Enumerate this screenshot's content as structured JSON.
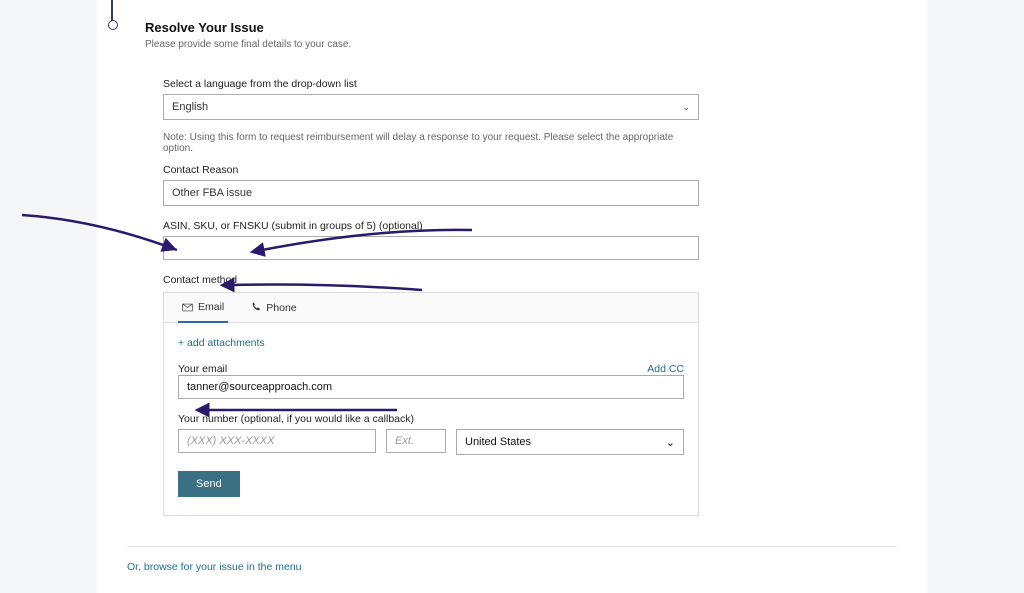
{
  "header": {
    "title": "Resolve Your Issue",
    "subtitle": "Please provide some final details to your case."
  },
  "language": {
    "label": "Select a language from the drop-down list",
    "selected": "English"
  },
  "note": "Note: Using this form to request reimbursement will delay a response to your request. Please select the appropriate option.",
  "reason": {
    "label": "Contact Reason",
    "value": "Other FBA issue"
  },
  "asin": {
    "label": "ASIN, SKU, or FNSKU (submit in groups of 5) (optional)",
    "value": ""
  },
  "contact_method_label": "Contact method",
  "tabs": {
    "email": "Email",
    "phone": "Phone"
  },
  "add_attachments": "+ add attachments",
  "email_section": {
    "label": "Your email",
    "add_cc": "Add CC",
    "value": "tanner@sourceapproach.com"
  },
  "phone_section": {
    "label": "Your number (optional, if you would like a callback)",
    "phone_placeholder": "(XXX) XXX-XXXX",
    "ext_placeholder": "Ext.",
    "country": "United States"
  },
  "send_label": "Send",
  "browse_link": "Or, browse for your issue in the menu"
}
